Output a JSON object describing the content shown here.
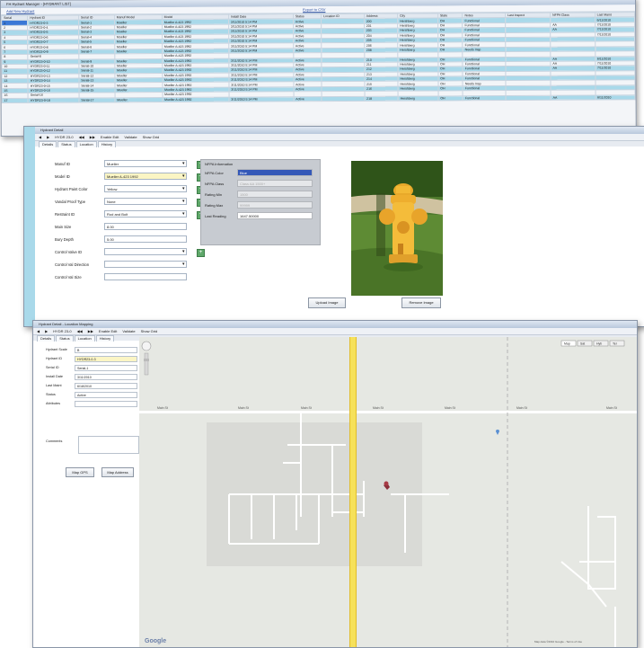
{
  "grid_window": {
    "title": "FH Hydrant Manager - [HYDRANT LIST]",
    "link_left": "Add New Hydrant",
    "link_center": "Export to CSV",
    "columns": [
      "Serial",
      "Hydrant ID",
      "Serial ID",
      "Manuf Model",
      "Model",
      "Install Date",
      "Status",
      "Location ID",
      "Address",
      "City",
      "State",
      "Notes",
      "Last Inspect",
      "NFPA Class",
      "Last Maint"
    ],
    "rows": [
      [
        "1",
        "HYDR23-0-3",
        "Serial-1",
        "Mueller",
        "Mueller A-423 1992",
        "3/11/2010 5:14 PM",
        "Active",
        "",
        "200",
        "Hershberg",
        "OH",
        "Functional",
        "",
        "",
        "6/11/2010"
      ],
      [
        "2",
        "HYDR23-0-4",
        "Serial-2",
        "Mueller",
        "Mueller A-423 1992",
        "3/11/2010 5:14 PM",
        "Active",
        "",
        "201",
        "Hershberg",
        "OH",
        "Functional",
        "",
        "AA",
        "7/11/2010"
      ],
      [
        "3",
        "HYDR23-0-5",
        "Serial-3",
        "Mueller",
        "Mueller A-423 1992",
        "3/11/2010 5:14 PM",
        "Active",
        "",
        "203",
        "Hershberg",
        "OH",
        "Functional",
        "",
        "AA",
        "7/11/2010"
      ],
      [
        "4",
        "HYDR23-0-6",
        "Serial-4",
        "Mueller",
        "Mueller A-423 1992",
        "3/11/2010 5:14 PM",
        "Active",
        "",
        "204",
        "Hershberg",
        "OH",
        "Functional",
        "",
        "",
        "7/11/2010"
      ],
      [
        "5",
        "HYDR23-0-7",
        "Serial-5",
        "Mueller",
        "Mueller A-423 1992",
        "3/11/2010 5:14 PM",
        "Active",
        "",
        "205",
        "Hershberg",
        "OH",
        "Functional",
        "",
        "",
        ""
      ],
      [
        "6",
        "HYDR23-0-8",
        "Serial-6",
        "Mueller",
        "Mueller A-423 1992",
        "3/11/2010 5:14 PM",
        "Active",
        "",
        "206",
        "Hershberg",
        "OH",
        "Functional",
        "",
        "",
        ""
      ],
      [
        "7",
        "HYDR23-0-9",
        "Serial-7",
        "Mueller",
        "Mueller A-423 1992",
        "3/11/2010 5:14 PM",
        "Active",
        "",
        "208",
        "Hershberg",
        "OH",
        "Needs Insp",
        "",
        "",
        ""
      ],
      [
        "8",
        "Serial-8",
        "",
        "",
        "Mueller A-423 1992",
        "",
        "",
        "",
        "",
        "",
        "",
        "",
        "",
        "",
        ""
      ],
      [
        "9",
        "HYDR23-0-10",
        "Serial-9",
        "Mueller",
        "Mueller A-423 1992",
        "3/11/2010 5:14 PM",
        "Active",
        "",
        "210",
        "Hershberg",
        "OH",
        "Functional",
        "",
        "AA",
        "6/11/2010"
      ],
      [
        "10",
        "HYDR23-0-11",
        "Serial-10",
        "Mueller",
        "Mueller A-423 1992",
        "3/11/2010 5:14 PM",
        "Active",
        "",
        "211",
        "Hershberg",
        "OH",
        "Functional",
        "",
        "AA",
        "7/11/2010"
      ],
      [
        "11",
        "HYDR23-0-12",
        "Serial-11",
        "Mueller",
        "Mueller A-423 1992",
        "3/11/2010 5:14 PM",
        "Active",
        "",
        "212",
        "Hershberg",
        "OH",
        "Functional",
        "",
        "AA",
        "7/11/2010"
      ],
      [
        "12",
        "HYDR23-0-13",
        "Serial-12",
        "Mueller",
        "Mueller A-423 1992",
        "3/11/2010 5:14 PM",
        "Active",
        "",
        "213",
        "Hershberg",
        "OH",
        "Functional",
        "",
        "",
        ""
      ],
      [
        "13",
        "HYDR23-0-14",
        "Serial-13",
        "Mueller",
        "Mueller A-423 1992",
        "3/11/2010 5:14 PM",
        "Active",
        "",
        "214",
        "Hershberg",
        "OH",
        "Functional",
        "",
        "",
        ""
      ],
      [
        "14",
        "HYDR23-0-15",
        "Serial-14",
        "Mueller",
        "Mueller A-423 1992",
        "3/11/2010 5:14 PM",
        "Active",
        "",
        "215",
        "Hershberg",
        "OH",
        "Needs Insp",
        "",
        "",
        ""
      ],
      [
        "15",
        "HYDR23-0-16",
        "Serial-15",
        "Mueller",
        "Mueller A-423 1992",
        "3/11/2010 5:14 PM",
        "Active",
        "",
        "216",
        "Hershberg",
        "OH",
        "Functional",
        "",
        "",
        ""
      ],
      [
        "16",
        "Serial-16",
        "",
        "",
        "Mueller A-423 1992",
        "",
        "",
        "",
        "",
        "",
        "",
        "",
        "",
        "",
        ""
      ],
      [
        "17",
        "HYDR23-0-18",
        "Serial-17",
        "Mueller",
        "Mueller A-423 1992",
        "3/11/2010 5:14 PM",
        "Active",
        "",
        "218",
        "Hershberg",
        "OH",
        "Functional",
        "",
        "AA",
        "6/11/2010"
      ]
    ]
  },
  "detail_window": {
    "title": "Hydrant Detail",
    "toolbar": [
      "◀",
      "▶",
      "HYDR 23-0",
      "◀◀",
      "▶▶",
      "Enable Edit",
      "Validate",
      "Show Grid"
    ],
    "tabs": [
      "Details",
      "Status",
      "Location",
      "History"
    ],
    "fields": [
      {
        "label": "Manuf ID",
        "value": "Mueller",
        "dd": true,
        "plus": true,
        "yellow": false
      },
      {
        "label": "Model ID",
        "value": "Mueller A-423 1992",
        "dd": true,
        "plus": true,
        "yellow": true
      },
      {
        "label": "Hydrant Paint Color",
        "value": "Yellow",
        "dd": true,
        "plus": true,
        "yellow": false
      },
      {
        "label": "Vandal Proof Type",
        "value": "None",
        "dd": true,
        "plus": true,
        "yellow": false
      },
      {
        "label": "Restraint ID",
        "value": "Rod and Bolt",
        "dd": true,
        "plus": true,
        "yellow": false
      },
      {
        "label": "Main Size",
        "value": "8.00",
        "dd": false,
        "plus": false,
        "yellow": false
      },
      {
        "label": "Bury Depth",
        "value": "5.00",
        "dd": false,
        "plus": false,
        "yellow": false
      },
      {
        "label": "Control Valve ID",
        "value": "",
        "dd": true,
        "plus": true,
        "yellow": false
      },
      {
        "label": "Control Val Direction",
        "value": "",
        "dd": true,
        "plus": false,
        "yellow": false
      },
      {
        "label": "Control Val Size",
        "value": "",
        "dd": false,
        "plus": false,
        "yellow": false
      }
    ],
    "nfpa": {
      "header": "NFPA Information",
      "rows": [
        {
          "label": "NFPA Color",
          "value": "Blue",
          "style": "blue"
        },
        {
          "label": "NFPA Class",
          "value": "Class AA 1500+",
          "style": "grey"
        },
        {
          "label": "Rating Min",
          "value": "1500",
          "style": "grey"
        },
        {
          "label": "Rating Max",
          "value": "99999",
          "style": "grey"
        },
        {
          "label": "Last Reading",
          "value": "1647.50000",
          "style": "white"
        }
      ]
    },
    "upload_button": "Upload Image",
    "remove_button": "Remove Image"
  },
  "map_window": {
    "title": "Hydrant Detail - Location Mapping",
    "toolbar": [
      "◀",
      "▶",
      "HYDR 23-0",
      "◀◀",
      "▶▶",
      "Enable Edit",
      "Validate",
      "Show Grid"
    ],
    "tabs": [
      "Details",
      "Status",
      "Location",
      "History"
    ],
    "fields": [
      {
        "label": "Hydrant Scale",
        "value": "B",
        "yellow": false
      },
      {
        "label": "Hydrant ID",
        "value": "HYDR23-0-3",
        "yellow": true
      },
      {
        "label": "Serial ID",
        "value": "Serial-1",
        "yellow": false
      },
      {
        "label": "Install Date",
        "value": "3/11/2010",
        "yellow": false
      },
      {
        "label": "Last Maint",
        "value": "6/18/2010",
        "yellow": false
      },
      {
        "label": "Status",
        "value": "Active",
        "yellow": false
      },
      {
        "label": "Attributes",
        "value": "",
        "yellow": false
      }
    ],
    "comments_label": "Comments",
    "map_gps_button": "Map GPS",
    "map_address_button": "Map Address",
    "map_type_buttons": [
      "Map",
      "Sat",
      "Hyb",
      "Ter"
    ],
    "google_logo": "Google",
    "copyright": "Map data ©2010 Google - Terms of Use",
    "colors": {
      "major_road": "#f6e15a",
      "grass": "#e6e8e3",
      "block": "#d6d7d3"
    }
  }
}
